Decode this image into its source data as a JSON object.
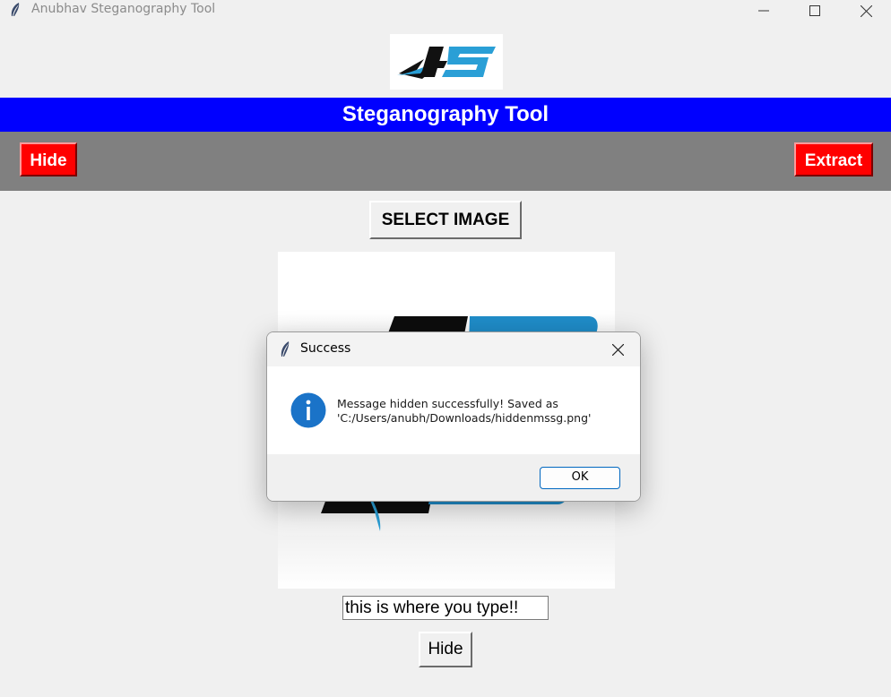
{
  "window": {
    "title": "Anubhav Steganography Tool",
    "icon": "feather-icon",
    "controls": [
      "minimize-icon",
      "maximize-icon",
      "close-icon"
    ]
  },
  "header": {
    "logo_text": "AS",
    "banner_title": "Steganography Tool",
    "banner_color": "#0000ff"
  },
  "toolbar": {
    "hide_label": "Hide",
    "extract_label": "Extract",
    "button_color": "#ff0000",
    "background": "#808080"
  },
  "main": {
    "select_image_label": "SELECT IMAGE",
    "preview_image": "AS logo",
    "message_input_value": "this is where you type!!",
    "hide_button_label": "Hide"
  },
  "dialog": {
    "title": "Success",
    "icon": "info-icon",
    "message_line1": "Message hidden successfully! Saved as",
    "message_line2": "'C:/Users/anubh/Downloads/hiddenmssg.png'",
    "ok_label": "OK",
    "accent_color": "#0067c0"
  }
}
